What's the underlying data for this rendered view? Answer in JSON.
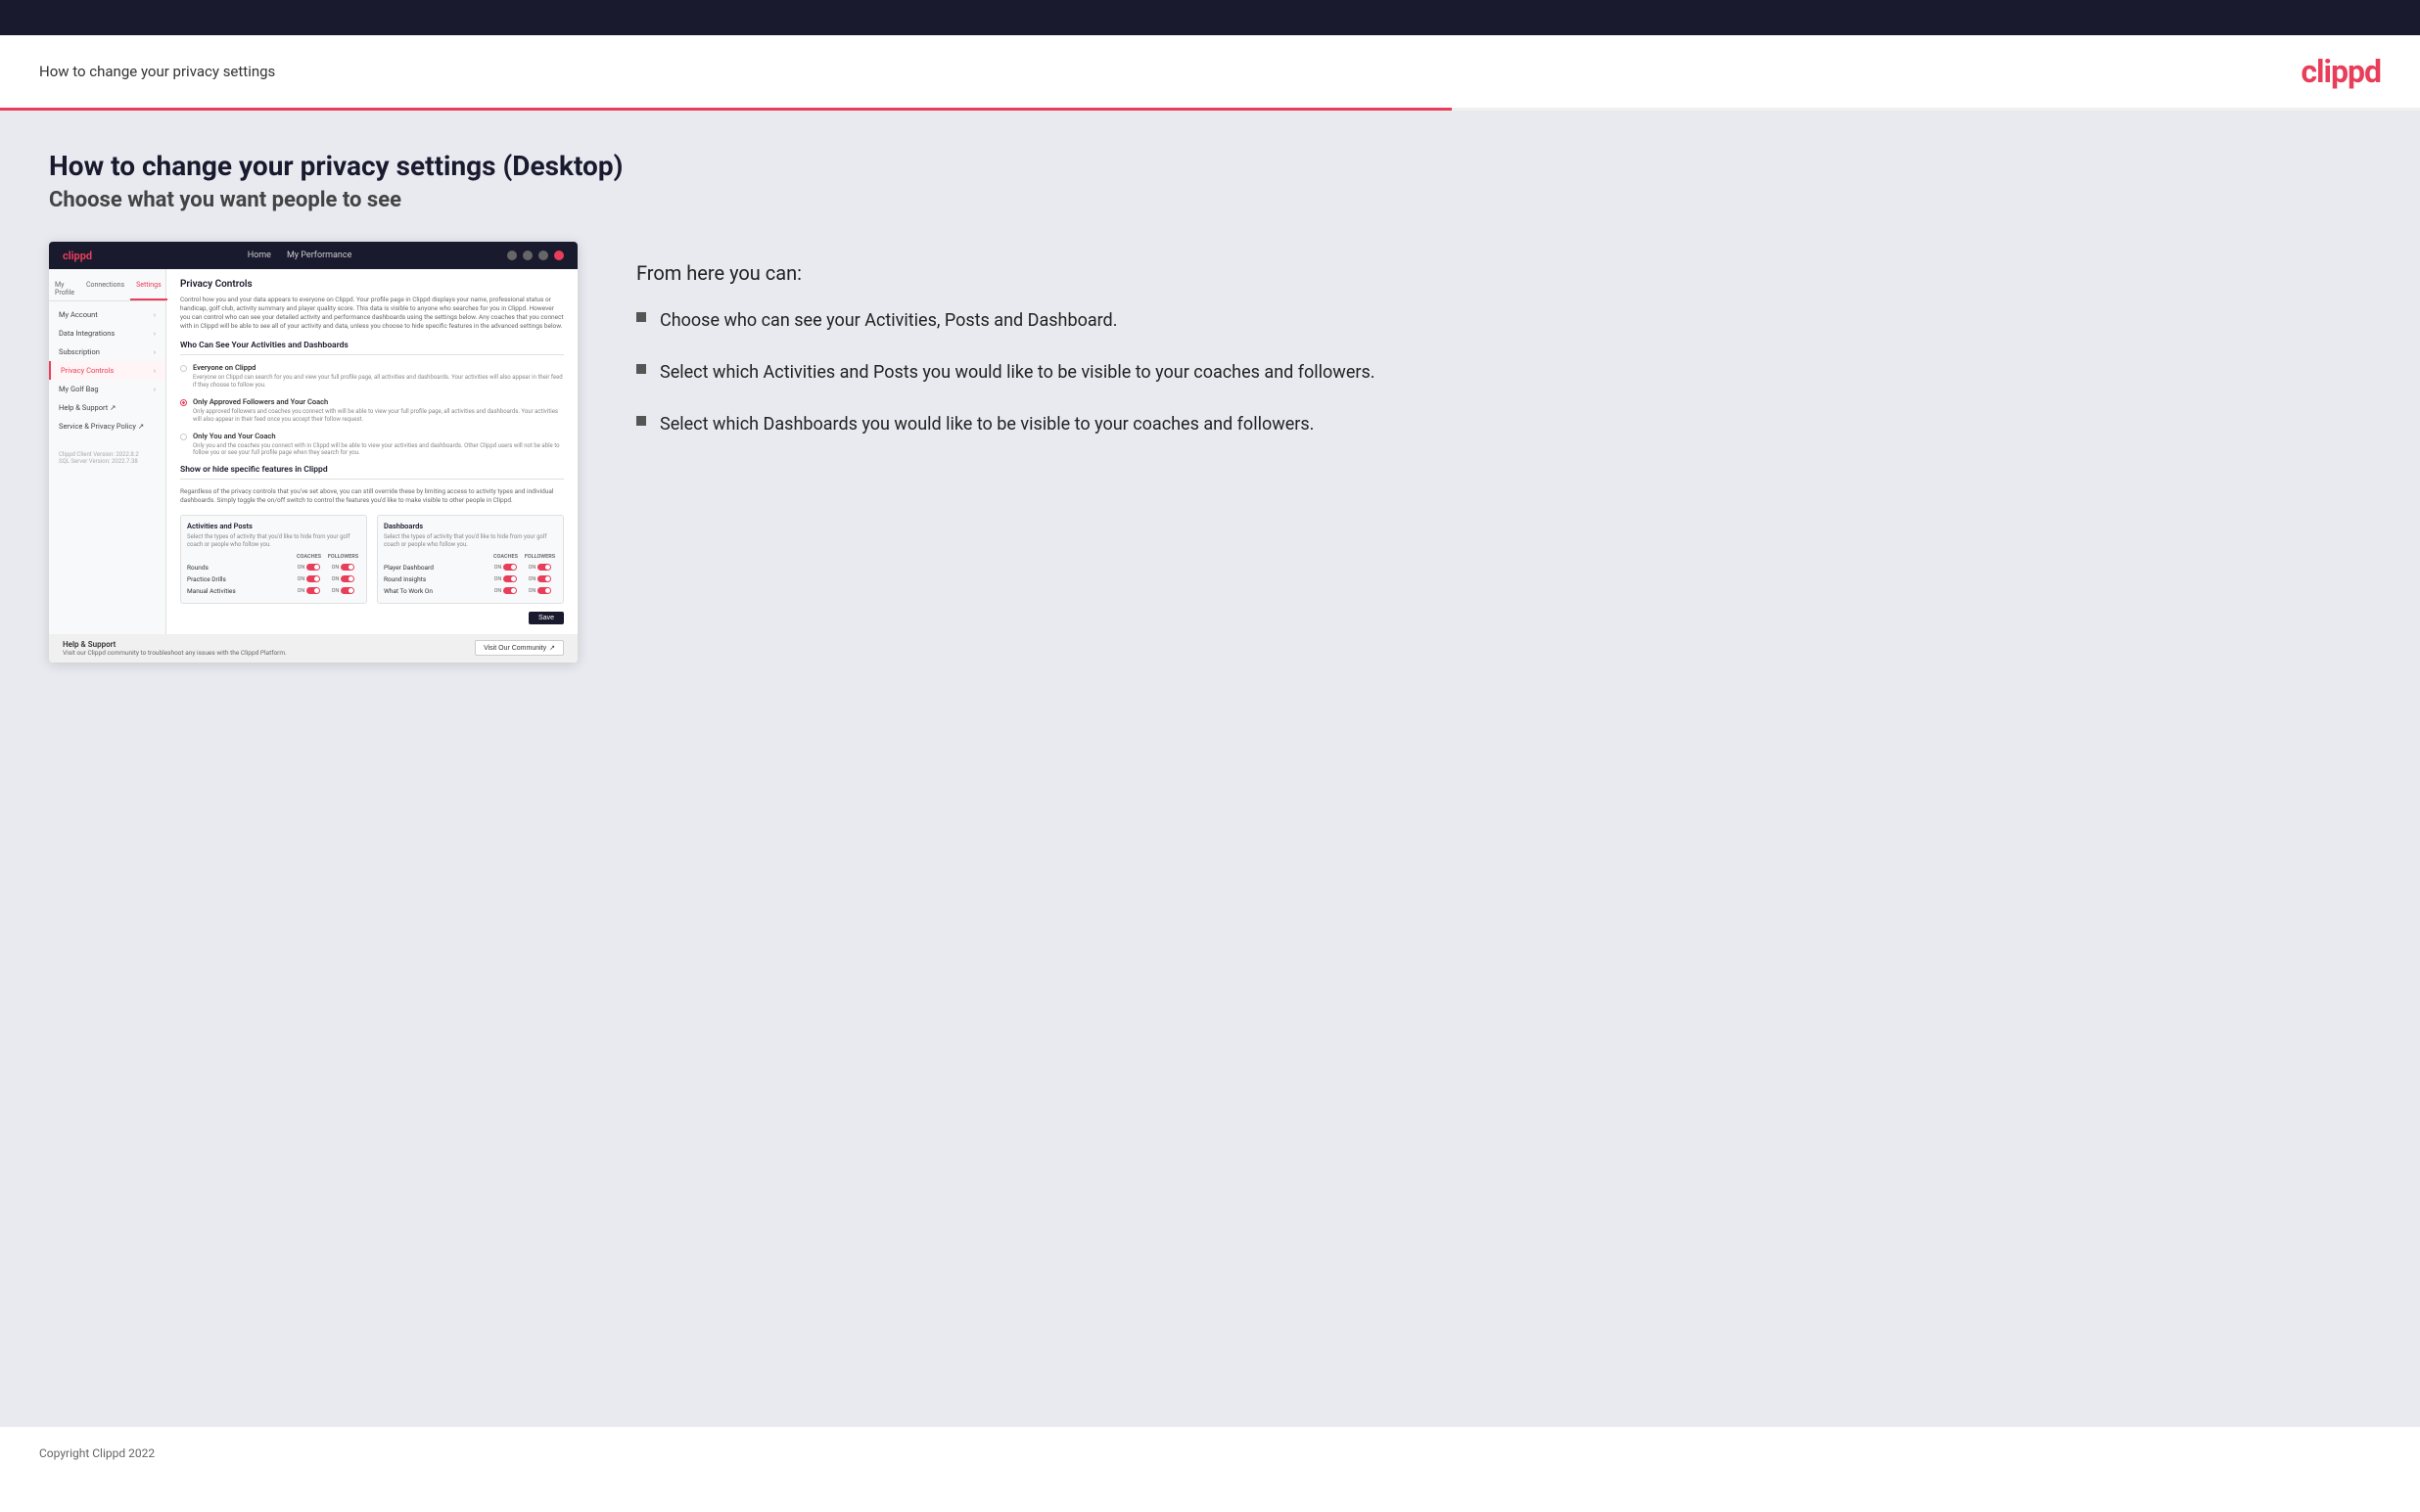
{
  "header": {
    "title": "How to change your privacy settings",
    "logo": "clippd"
  },
  "page": {
    "heading": "How to change your privacy settings (Desktop)",
    "subheading": "Choose what you want people to see"
  },
  "info_panel": {
    "from_here": "From here you can:",
    "bullets": [
      "Choose who can see your Activities, Posts and Dashboard.",
      "Select which Activities and Posts you would like to be visible to your coaches and followers.",
      "Select which Dashboards you would like to be visible to your coaches and followers."
    ]
  },
  "app_mockup": {
    "nav": {
      "logo": "clippd",
      "links": [
        "Home",
        "My Performance"
      ]
    },
    "sidebar_tabs": [
      "My Profile",
      "Connections",
      "Settings"
    ],
    "sidebar_items": [
      {
        "label": "My Account",
        "active": false
      },
      {
        "label": "Data Integrations",
        "active": false
      },
      {
        "label": "Subscription",
        "active": false
      },
      {
        "label": "Privacy Controls",
        "active": true
      },
      {
        "label": "My Golf Bag",
        "active": false
      },
      {
        "label": "Help & Support",
        "active": false
      },
      {
        "label": "Service & Privacy Policy",
        "active": false
      }
    ],
    "version": "Clippd Client Version: 2022.8.2\nSQL Server Version: 2022.7.38",
    "main": {
      "section_title": "Privacy Controls",
      "section_desc": "Control how you and your data appears to everyone on Clippd. Your profile page in Clippd displays your name, professional status or handicap, golf club, activity summary and player quality score. This data is visible to anyone who searches for you in Clippd. However you can control who can see your detailed activity and performance dashboards using the settings below. Any coaches that you connect with in Clippd will be able to see all of your activity and data, unless you choose to hide specific features in the advanced settings below.",
      "who_can_see_title": "Who Can See Your Activities and Dashboards",
      "radio_options": [
        {
          "label": "Everyone on Clippd",
          "desc": "Everyone on Clippd can search for you and view your full profile page, all activities and dashboards. Your activities will also appear in their feed if they choose to follow you.",
          "selected": false
        },
        {
          "label": "Only Approved Followers and Your Coach",
          "desc": "Only approved followers and coaches you connect with will be able to view your full profile page, all activities and dashboards. Your activities will also appear in their feed once you accept their follow request.",
          "selected": true
        },
        {
          "label": "Only You and Your Coach",
          "desc": "Only you and the coaches you connect with in Clippd will be able to view your activities and dashboards. Other Clippd users will not be able to follow you or see your full profile page when they search for you.",
          "selected": false
        }
      ],
      "show_hide_title": "Show or hide specific features in Clippd",
      "show_hide_desc": "Regardless of the privacy controls that you've set above, you can still override these by limiting access to activity types and individual dashboards. Simply toggle the on/off switch to control the features you'd like to make visible to other people in Clippd.",
      "activities_posts": {
        "title": "Activities and Posts",
        "desc": "Select the types of activity that you'd like to hide from your golf coach or people who follow you.",
        "columns": [
          "COACHES",
          "FOLLOWERS"
        ],
        "rows": [
          {
            "name": "Rounds",
            "coaches_on": true,
            "followers_on": true
          },
          {
            "name": "Practice Drills",
            "coaches_on": true,
            "followers_on": true
          },
          {
            "name": "Manual Activities",
            "coaches_on": true,
            "followers_on": true
          }
        ]
      },
      "dashboards": {
        "title": "Dashboards",
        "desc": "Select the types of activity that you'd like to hide from your golf coach or people who follow you.",
        "columns": [
          "COACHES",
          "FOLLOWERS"
        ],
        "rows": [
          {
            "name": "Player Dashboard",
            "coaches_on": true,
            "followers_on": true
          },
          {
            "name": "Round Insights",
            "coaches_on": true,
            "followers_on": true
          },
          {
            "name": "What To Work On",
            "coaches_on": true,
            "followers_on": true
          }
        ]
      },
      "save_label": "Save"
    },
    "help": {
      "title": "Help & Support",
      "desc": "Visit our Clippd community to troubleshoot any issues with the Clippd Platform.",
      "btn_label": "Visit Our Community"
    }
  },
  "footer": {
    "copyright": "Copyright Clippd 2022"
  }
}
